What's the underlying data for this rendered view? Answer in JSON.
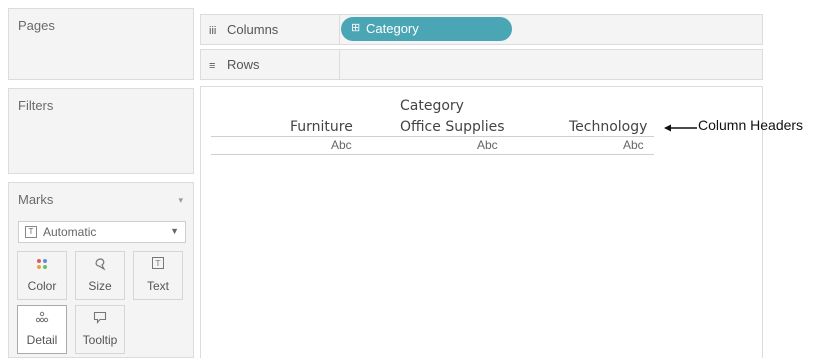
{
  "pages": {
    "title": "Pages"
  },
  "filters": {
    "title": "Filters"
  },
  "marks": {
    "title": "Marks",
    "mark_type": "Automatic",
    "buttons": [
      {
        "label": "Color",
        "icon": "color-dots-icon"
      },
      {
        "label": "Size",
        "icon": "size-icon"
      },
      {
        "label": "Text",
        "icon": "text-icon"
      },
      {
        "label": "Detail",
        "icon": "detail-icon"
      },
      {
        "label": "Tooltip",
        "icon": "tooltip-icon"
      }
    ]
  },
  "shelves": {
    "columns_label": "Columns",
    "rows_label": "Rows",
    "columns_pill": "Category"
  },
  "view": {
    "field_header": "Category",
    "columns": [
      "Furniture",
      "Office Supplies",
      "Technology"
    ],
    "cells": [
      "Abc",
      "Abc",
      "Abc"
    ]
  },
  "annotation": {
    "text": "Column Headers"
  },
  "colors": {
    "pill": "#4aa6b5",
    "panel": "#f4f4f4",
    "border": "#dcdcdc"
  }
}
